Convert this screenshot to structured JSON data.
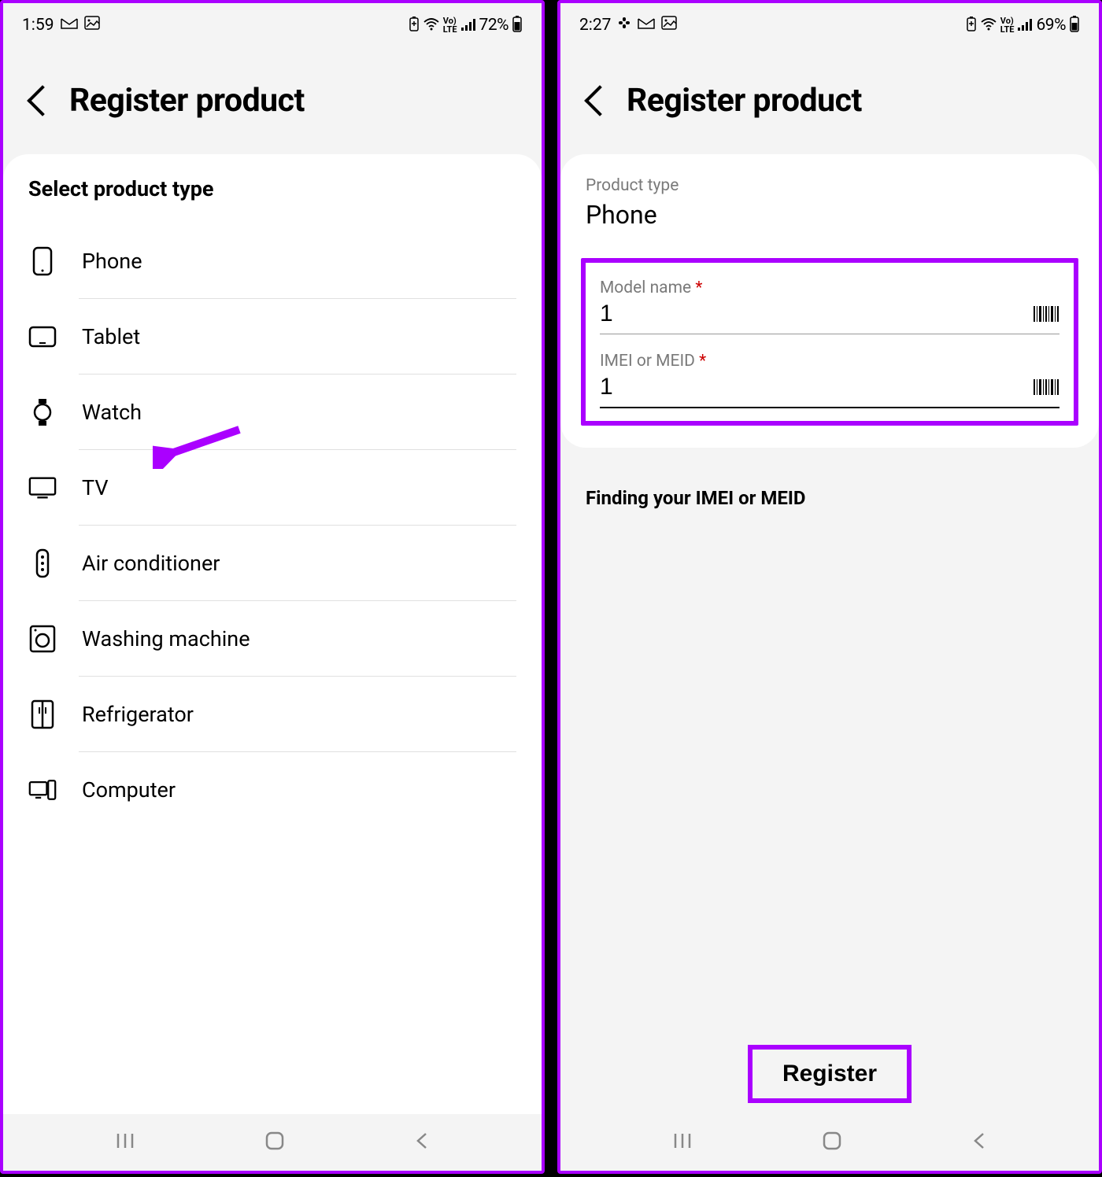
{
  "left": {
    "status": {
      "time": "1:59",
      "battery": "72%"
    },
    "title": "Register product",
    "section": "Select product type",
    "items": [
      {
        "label": "Phone"
      },
      {
        "label": "Tablet"
      },
      {
        "label": "Watch"
      },
      {
        "label": "TV"
      },
      {
        "label": "Air conditioner"
      },
      {
        "label": "Washing machine"
      },
      {
        "label": "Refrigerator"
      },
      {
        "label": "Computer"
      }
    ]
  },
  "right": {
    "status": {
      "time": "2:27",
      "battery": "69%"
    },
    "title": "Register product",
    "type_label": "Product type",
    "type_value": "Phone",
    "model_label": "Model name",
    "model_value": "1",
    "imei_label": "IMEI or MEID",
    "imei_value": "1",
    "help": "Finding your IMEI or MEID",
    "register": "Register"
  }
}
